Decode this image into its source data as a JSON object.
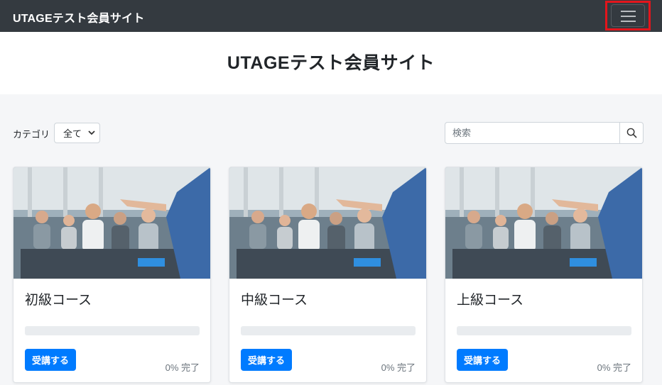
{
  "navbar": {
    "brand": "UTAGEテスト会員サイト",
    "menu_icon": "hamburger-icon"
  },
  "hero": {
    "title": "UTAGEテスト会員サイト"
  },
  "filter": {
    "label": "カテゴリ",
    "selected": "全て"
  },
  "search": {
    "placeholder": "検索",
    "value": "",
    "icon": "search-icon"
  },
  "courses": [
    {
      "title": "初級コース",
      "button_label": "受講する",
      "progress_text": "0% 完了",
      "progress": 0
    },
    {
      "title": "中級コース",
      "button_label": "受講する",
      "progress_text": "0% 完了",
      "progress": 0
    },
    {
      "title": "上級コース",
      "button_label": "受講する",
      "progress_text": "0% 完了",
      "progress": 0
    }
  ],
  "colors": {
    "navbar": "#343a40",
    "primary": "#007bff",
    "highlight": "#e3151c",
    "track": "#e9ecef"
  }
}
